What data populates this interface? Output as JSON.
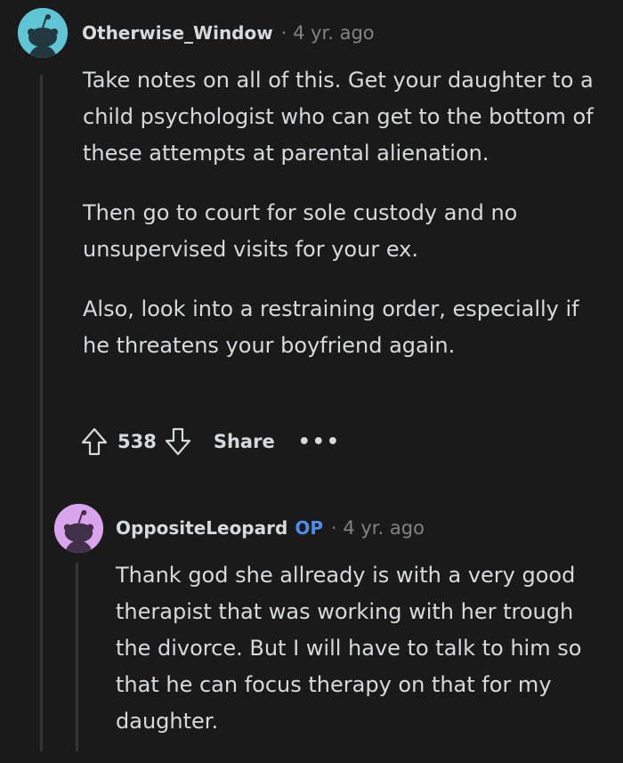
{
  "comments": [
    {
      "username": "Otherwise_Window",
      "time": "4 yr. ago",
      "paragraphs": [
        "Take notes on all of this. Get your daughter to a child psychologist who can get to the bottom of these attempts at parental alienation.",
        "Then go to court for sole custody and no unsupervised visits for your ex.",
        "Also, look into a restraining order, especially if he threatens your boyfriend again."
      ],
      "score": "538",
      "share_label": "Share",
      "more_label": "•••",
      "avatar_color": "#5fc4d3"
    },
    {
      "username": "OppositeLeopard",
      "op_badge": "OP",
      "time": "4 yr. ago",
      "paragraphs": [
        "Thank god she allready is with a very good therapist that was working with her trough the divorce. But I will have to talk to him so that he can focus therapy on that for my daughter."
      ],
      "avatar_color": "#d8a4ec"
    }
  ],
  "colors": {
    "background": "#1a1a1b",
    "text": "#d7dadc",
    "muted": "#818384",
    "op_badge": "#4e8ee8",
    "thread_line": "#343536"
  }
}
